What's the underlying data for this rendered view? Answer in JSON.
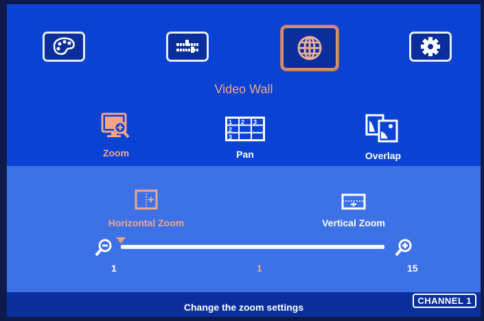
{
  "menu": {
    "top_icons": [
      {
        "name": "palette-icon"
      },
      {
        "name": "sliders-icon"
      },
      {
        "name": "globe-icon",
        "selected": true
      },
      {
        "name": "gear-icon"
      }
    ],
    "section_title": "Video Wall"
  },
  "submenu": {
    "items": [
      {
        "label": "Zoom",
        "icon": "zoom-screen-icon",
        "active": true
      },
      {
        "label": "Pan",
        "icon": "grid-icon",
        "active": false
      },
      {
        "label": "Overlap",
        "icon": "overlap-images-icon",
        "active": false
      }
    ],
    "pan_grid": [
      "1",
      "2",
      "3",
      "2",
      "3"
    ]
  },
  "zoom_panel": {
    "horizontal_label": "Horizontal Zoom",
    "vertical_label": "Vertical Zoom",
    "slider": {
      "min_label": "1",
      "current_label": "1",
      "max_label": "15",
      "min": 1,
      "max": 15,
      "value": 1
    }
  },
  "status": {
    "text": "Change the zoom settings",
    "channel": "CHANNEL 1"
  },
  "colors": {
    "background": "#0a43d4",
    "panel": "#3d72e6",
    "accent": "#f3a688"
  }
}
